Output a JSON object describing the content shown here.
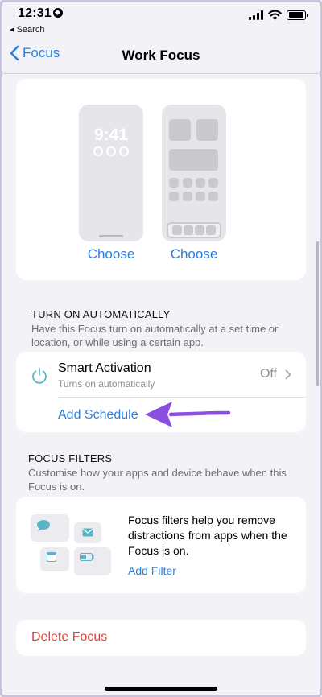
{
  "status": {
    "time": "12:31",
    "back_label": "◂ Search"
  },
  "nav": {
    "back_label": "Focus",
    "title": "Work Focus"
  },
  "screens": {
    "lock_time": "9:41",
    "choose_left": "Choose",
    "choose_right": "Choose"
  },
  "auto": {
    "header": "TURN ON AUTOMATICALLY",
    "footer": "Have this Focus turn on automatically at a set time or location, or while using a certain app.",
    "smart_title": "Smart Activation",
    "smart_subtitle": "Turns on automatically",
    "smart_value": "Off",
    "add_schedule": "Add Schedule"
  },
  "filters": {
    "header": "FOCUS FILTERS",
    "footer": "Customise how your apps and device behave when this Focus is on.",
    "description": "Focus filters help you remove distractions from apps when the Focus is on.",
    "add_filter": "Add Filter"
  },
  "delete_label": "Delete Focus",
  "colors": {
    "accent": "#2f7ddb",
    "destructive": "#e0403a",
    "annotation_arrow": "#8a4ee0",
    "icon_teal": "#5ab4c8"
  },
  "icons": [
    "location-icon",
    "signal-icon",
    "wifi-icon",
    "battery-icon",
    "back-chevron-icon",
    "power-icon",
    "chevron-right-icon",
    "message-icon",
    "mail-icon",
    "calendar-icon",
    "battery-small-icon",
    "arrow-annotation-icon"
  ]
}
